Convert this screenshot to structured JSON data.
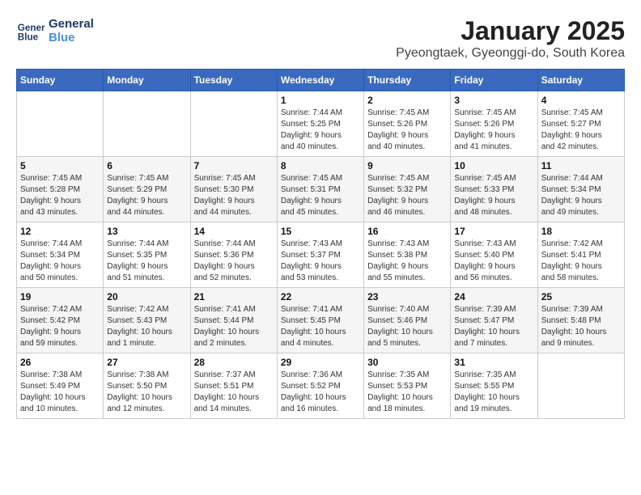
{
  "header": {
    "logo_line1": "General",
    "logo_line2": "Blue",
    "title": "January 2025",
    "subtitle": "Pyeongtaek, Gyeonggi-do, South Korea"
  },
  "weekdays": [
    "Sunday",
    "Monday",
    "Tuesday",
    "Wednesday",
    "Thursday",
    "Friday",
    "Saturday"
  ],
  "weeks": [
    [
      {
        "day": "",
        "info": ""
      },
      {
        "day": "",
        "info": ""
      },
      {
        "day": "",
        "info": ""
      },
      {
        "day": "1",
        "info": "Sunrise: 7:44 AM\nSunset: 5:25 PM\nDaylight: 9 hours\nand 40 minutes."
      },
      {
        "day": "2",
        "info": "Sunrise: 7:45 AM\nSunset: 5:26 PM\nDaylight: 9 hours\nand 40 minutes."
      },
      {
        "day": "3",
        "info": "Sunrise: 7:45 AM\nSunset: 5:26 PM\nDaylight: 9 hours\nand 41 minutes."
      },
      {
        "day": "4",
        "info": "Sunrise: 7:45 AM\nSunset: 5:27 PM\nDaylight: 9 hours\nand 42 minutes."
      }
    ],
    [
      {
        "day": "5",
        "info": "Sunrise: 7:45 AM\nSunset: 5:28 PM\nDaylight: 9 hours\nand 43 minutes."
      },
      {
        "day": "6",
        "info": "Sunrise: 7:45 AM\nSunset: 5:29 PM\nDaylight: 9 hours\nand 44 minutes."
      },
      {
        "day": "7",
        "info": "Sunrise: 7:45 AM\nSunset: 5:30 PM\nDaylight: 9 hours\nand 44 minutes."
      },
      {
        "day": "8",
        "info": "Sunrise: 7:45 AM\nSunset: 5:31 PM\nDaylight: 9 hours\nand 45 minutes."
      },
      {
        "day": "9",
        "info": "Sunrise: 7:45 AM\nSunset: 5:32 PM\nDaylight: 9 hours\nand 46 minutes."
      },
      {
        "day": "10",
        "info": "Sunrise: 7:45 AM\nSunset: 5:33 PM\nDaylight: 9 hours\nand 48 minutes."
      },
      {
        "day": "11",
        "info": "Sunrise: 7:44 AM\nSunset: 5:34 PM\nDaylight: 9 hours\nand 49 minutes."
      }
    ],
    [
      {
        "day": "12",
        "info": "Sunrise: 7:44 AM\nSunset: 5:34 PM\nDaylight: 9 hours\nand 50 minutes."
      },
      {
        "day": "13",
        "info": "Sunrise: 7:44 AM\nSunset: 5:35 PM\nDaylight: 9 hours\nand 51 minutes."
      },
      {
        "day": "14",
        "info": "Sunrise: 7:44 AM\nSunset: 5:36 PM\nDaylight: 9 hours\nand 52 minutes."
      },
      {
        "day": "15",
        "info": "Sunrise: 7:43 AM\nSunset: 5:37 PM\nDaylight: 9 hours\nand 53 minutes."
      },
      {
        "day": "16",
        "info": "Sunrise: 7:43 AM\nSunset: 5:38 PM\nDaylight: 9 hours\nand 55 minutes."
      },
      {
        "day": "17",
        "info": "Sunrise: 7:43 AM\nSunset: 5:40 PM\nDaylight: 9 hours\nand 56 minutes."
      },
      {
        "day": "18",
        "info": "Sunrise: 7:42 AM\nSunset: 5:41 PM\nDaylight: 9 hours\nand 58 minutes."
      }
    ],
    [
      {
        "day": "19",
        "info": "Sunrise: 7:42 AM\nSunset: 5:42 PM\nDaylight: 9 hours\nand 59 minutes."
      },
      {
        "day": "20",
        "info": "Sunrise: 7:42 AM\nSunset: 5:43 PM\nDaylight: 10 hours\nand 1 minute."
      },
      {
        "day": "21",
        "info": "Sunrise: 7:41 AM\nSunset: 5:44 PM\nDaylight: 10 hours\nand 2 minutes."
      },
      {
        "day": "22",
        "info": "Sunrise: 7:41 AM\nSunset: 5:45 PM\nDaylight: 10 hours\nand 4 minutes."
      },
      {
        "day": "23",
        "info": "Sunrise: 7:40 AM\nSunset: 5:46 PM\nDaylight: 10 hours\nand 5 minutes."
      },
      {
        "day": "24",
        "info": "Sunrise: 7:39 AM\nSunset: 5:47 PM\nDaylight: 10 hours\nand 7 minutes."
      },
      {
        "day": "25",
        "info": "Sunrise: 7:39 AM\nSunset: 5:48 PM\nDaylight: 10 hours\nand 9 minutes."
      }
    ],
    [
      {
        "day": "26",
        "info": "Sunrise: 7:38 AM\nSunset: 5:49 PM\nDaylight: 10 hours\nand 10 minutes."
      },
      {
        "day": "27",
        "info": "Sunrise: 7:38 AM\nSunset: 5:50 PM\nDaylight: 10 hours\nand 12 minutes."
      },
      {
        "day": "28",
        "info": "Sunrise: 7:37 AM\nSunset: 5:51 PM\nDaylight: 10 hours\nand 14 minutes."
      },
      {
        "day": "29",
        "info": "Sunrise: 7:36 AM\nSunset: 5:52 PM\nDaylight: 10 hours\nand 16 minutes."
      },
      {
        "day": "30",
        "info": "Sunrise: 7:35 AM\nSunset: 5:53 PM\nDaylight: 10 hours\nand 18 minutes."
      },
      {
        "day": "31",
        "info": "Sunrise: 7:35 AM\nSunset: 5:55 PM\nDaylight: 10 hours\nand 19 minutes."
      },
      {
        "day": "",
        "info": ""
      }
    ]
  ]
}
